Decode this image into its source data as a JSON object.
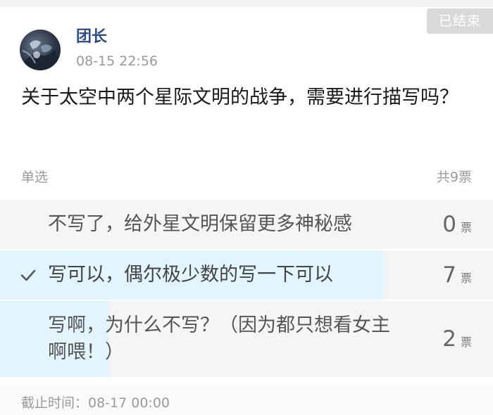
{
  "post": {
    "status": "已结束",
    "author": "团长",
    "time": "08-15 22:56",
    "question": "关于太空中两个星际文明的战争，需要进行描写吗？"
  },
  "poll": {
    "type_label": "单选",
    "total_label": "共9票",
    "total_votes": 9,
    "selected_option": 2,
    "options": [
      {
        "text": "不写了，给外星文明保留更多神秘感",
        "votes": "0",
        "unit": "票",
        "selected": false,
        "share": 0.0
      },
      {
        "text": "写可以，偶尔极少数的写一下可以",
        "votes": "7",
        "unit": "票",
        "selected": true,
        "share": 0.778
      },
      {
        "text": "写啊，为什么不写？（因为都只想看女主啊喂！）",
        "votes": "2",
        "unit": "票",
        "selected": false,
        "share": 0.222
      }
    ],
    "deadline": "截止时间：08-17 00:00"
  },
  "colors": {
    "author": "#2b4a86",
    "fill": "#e2f4fd",
    "option_bg": "#f5f5f5",
    "badge_bg": "#d9d9d9",
    "muted": "#9a9a9a"
  },
  "icons": {
    "selected": "check-icon",
    "avatar": "avatar-image"
  }
}
